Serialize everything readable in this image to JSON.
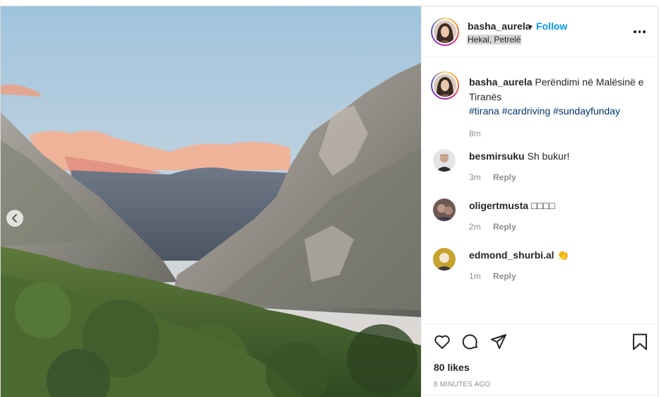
{
  "post": {
    "author": {
      "username": "basha_aurela",
      "separator": "•",
      "follow_label": "Follow",
      "location": "Hekal, Petrelë"
    },
    "caption": {
      "username": "basha_aurela",
      "text": "Perëndimi në Malësinë e Tiranës",
      "hashtags": [
        "#tirana",
        "#cardriving",
        "#sundayfunday"
      ],
      "time": "8m"
    },
    "comments": [
      {
        "username": "besmirsuku",
        "text": "Sh bukur!",
        "time": "3m",
        "reply_label": "Reply"
      },
      {
        "username": "oligertmusta",
        "text": "□□□□",
        "time": "2m",
        "reply_label": "Reply"
      },
      {
        "username": "edmond_shurbi.al",
        "text": "👏",
        "time": "1m",
        "reply_label": "Reply"
      }
    ],
    "likes": "80 likes",
    "timestamp": "8 MINUTES AGO",
    "icons": [
      "more-options-icon",
      "chevron-left-icon",
      "heart-icon",
      "comment-icon",
      "share-icon",
      "bookmark-icon"
    ],
    "colors": {
      "follow": "#0095f6",
      "hashtag": "#00376b",
      "muted": "#8e8e8e"
    }
  }
}
